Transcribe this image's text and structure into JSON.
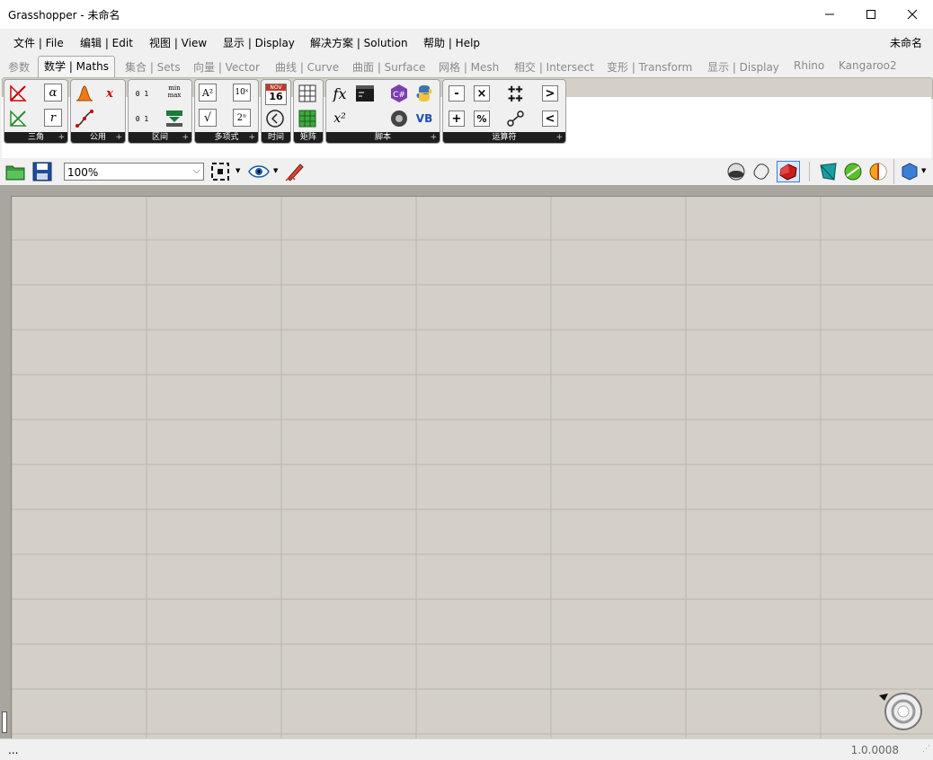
{
  "window": {
    "title": "Grasshopper - 未命名",
    "minimize": "—",
    "maximize": "☐",
    "close": "✕"
  },
  "menu": {
    "items": [
      "文件 | File",
      "编辑 | Edit",
      "视图 | View",
      "显示 | Display",
      "解决方案 | Solution",
      "帮助 | Help"
    ],
    "document_name": "未命名"
  },
  "tabs": [
    "参数",
    "数学 | Maths",
    "集合 | Sets",
    "向量 | Vector",
    "曲线 | Curve",
    "曲面 | Surface",
    "网格 | Mesh",
    "相交 | Intersect",
    "变形 | Transform",
    "显示 | Display",
    "Rhino",
    "Kangaroo2"
  ],
  "active_tab": "数学 | Maths",
  "ribbon_groups": [
    "三角",
    "公用",
    "区间",
    "多项式",
    "时间",
    "矩阵",
    "脚本",
    "运算符"
  ],
  "ribbon_icons": {
    "alpha": "α",
    "r": "r",
    "x_red": "x",
    "min": "min",
    "max": "max",
    "a2": "A²",
    "sqrt": "√",
    "pow10": "10ˣ",
    "pow2": "2ⁿ",
    "calendar_month": "NOV",
    "calendar_day": "16",
    "fx": "fx",
    "x2": "x²",
    "csharp": "C#",
    "vb": "VB",
    "minus": "-",
    "times": "×",
    "plus": "+",
    "percent": "%",
    "gt": ">",
    "lt": "<",
    "bits": "0 1"
  },
  "toolbar": {
    "zoom": "100%"
  },
  "status": {
    "left": "...",
    "version": "1.0.0008"
  },
  "colors": {
    "canvas": "#d4d0c8",
    "grid": "#b9b6b0",
    "ribbon_label_bg": "#1e1e1e"
  }
}
